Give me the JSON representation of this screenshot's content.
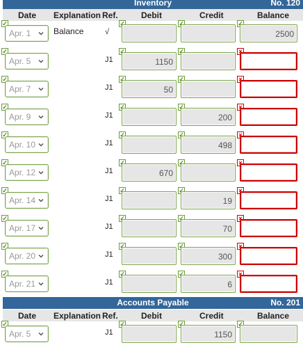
{
  "ledger1": {
    "title": "Inventory",
    "number": "No. 120",
    "headers": {
      "date": "Date",
      "explanation": "Explanation",
      "ref": "Ref.",
      "debit": "Debit",
      "credit": "Credit",
      "balance": "Balance"
    },
    "rows": [
      {
        "date": "Apr. 1",
        "explanation": "Balance",
        "ref": "√",
        "debit": "",
        "credit": "",
        "balance": "2500"
      },
      {
        "date": "Apr. 5",
        "explanation": "",
        "ref": "J1",
        "debit": "1150",
        "credit": "",
        "balance": ""
      },
      {
        "date": "Apr. 7",
        "explanation": "",
        "ref": "J1",
        "debit": "50",
        "credit": "",
        "balance": ""
      },
      {
        "date": "Apr. 9",
        "explanation": "",
        "ref": "J1",
        "debit": "",
        "credit": "200",
        "balance": ""
      },
      {
        "date": "Apr. 10",
        "explanation": "",
        "ref": "J1",
        "debit": "",
        "credit": "498",
        "balance": ""
      },
      {
        "date": "Apr. 12",
        "explanation": "",
        "ref": "J1",
        "debit": "670",
        "credit": "",
        "balance": ""
      },
      {
        "date": "Apr. 14",
        "explanation": "",
        "ref": "J1",
        "debit": "",
        "credit": "19",
        "balance": ""
      },
      {
        "date": "Apr. 17",
        "explanation": "",
        "ref": "J1",
        "debit": "",
        "credit": "70",
        "balance": ""
      },
      {
        "date": "Apr. 20",
        "explanation": "",
        "ref": "J1",
        "debit": "",
        "credit": "300",
        "balance": ""
      },
      {
        "date": "Apr. 21",
        "explanation": "",
        "ref": "J1",
        "debit": "",
        "credit": "6",
        "balance": ""
      }
    ]
  },
  "ledger2": {
    "title": "Accounts Payable",
    "number": "No. 201",
    "headers": {
      "date": "Date",
      "explanation": "Explanation",
      "ref": "Ref.",
      "debit": "Debit",
      "credit": "Credit",
      "balance": "Balance"
    },
    "rows": [
      {
        "date": "Apr. 5",
        "explanation": "",
        "ref": "J1",
        "debit": "",
        "credit": "1150",
        "balance": ""
      }
    ]
  },
  "marks": {
    "correct": "✓",
    "incorrect": "×"
  },
  "icons": {
    "check": "check-icon",
    "cross": "cross-icon",
    "chevron": "chevron-down-icon"
  },
  "colors": {
    "banner": "#336699",
    "correct": "#7aa34a",
    "incorrect": "#cc0000",
    "field": "#e6e6e6"
  }
}
